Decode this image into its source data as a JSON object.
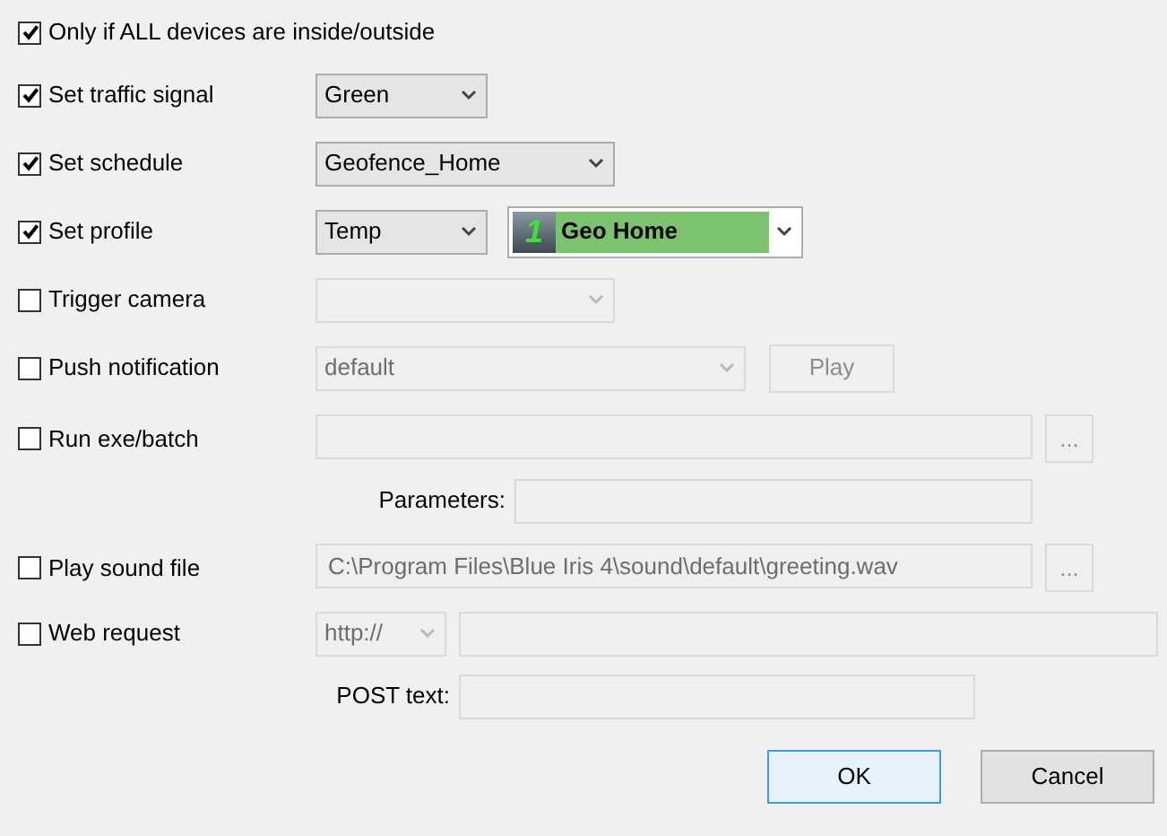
{
  "options": [
    {
      "kind": "plain",
      "label": "Only if ALL devices are inside/outside",
      "checked": true
    },
    {
      "kind": "select",
      "label": "Set traffic signal",
      "checked": true,
      "disabled": false,
      "value": "Green"
    },
    {
      "kind": "select",
      "label": "Set schedule",
      "checked": true,
      "disabled": false,
      "value": "Geofence_Home"
    },
    {
      "kind": "profile",
      "label": "Set profile",
      "checked": true,
      "disabled": false,
      "value": "Temp",
      "profile": {
        "number": "1",
        "name": "Geo Home"
      }
    },
    {
      "kind": "select",
      "label": "Trigger camera",
      "checked": false,
      "disabled": true
    },
    {
      "kind": "select_button",
      "label": "Push notification",
      "checked": false,
      "disabled": true,
      "value": "default",
      "button": "Play"
    },
    {
      "kind": "file",
      "label": "Run exe/batch",
      "checked": false,
      "disabled": true,
      "button": "...",
      "sub_label": "Parameters:"
    },
    {
      "kind": "file",
      "label": "Play sound file",
      "checked": false,
      "disabled": true,
      "value": "C:\\Program Files\\Blue Iris 4\\sound\\default\\greeting.wav",
      "button": "..."
    },
    {
      "kind": "web",
      "label": "Web request",
      "checked": false,
      "disabled": true,
      "scheme": "http://",
      "sub_label": "POST text:"
    }
  ],
  "buttons": [
    {
      "label": "OK",
      "default": true
    },
    {
      "label": "Cancel",
      "default": false
    }
  ]
}
